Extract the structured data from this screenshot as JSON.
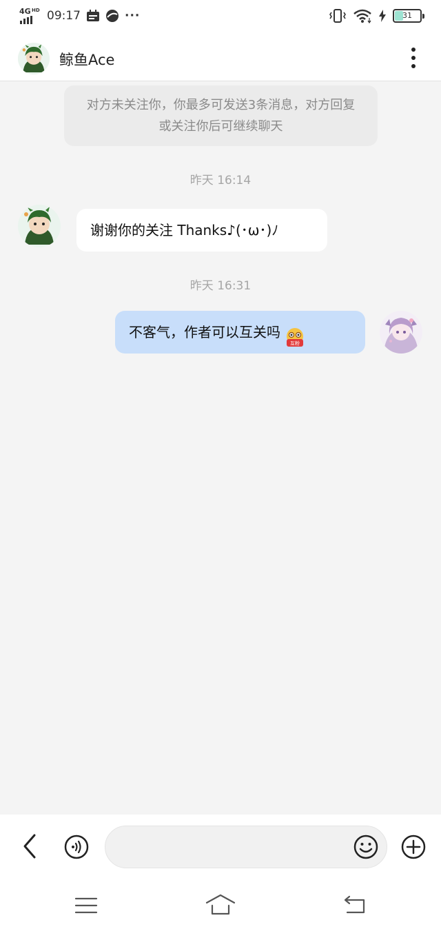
{
  "status_bar": {
    "network": "4G",
    "network_hd": "HD",
    "time": "09:17",
    "more": "···",
    "battery": "31",
    "battery_percent": 31,
    "icons": [
      "signal-icon",
      "calendar-icon",
      "app-icon",
      "vibrate-icon",
      "wifi-icon",
      "charging-icon",
      "battery-icon"
    ]
  },
  "header": {
    "title": "鲸鱼Ace",
    "avatar_icon": "avatar-dino-boy",
    "more_icon": "more-vertical-icon"
  },
  "notice": "对方未关注你，你最多可发送3条消息，对方回复或关注你后可继续聊天",
  "messages": [
    {
      "timestamp": "昨天 16:14",
      "direction": "incoming",
      "text": "谢谢你的关注 Thanks♪(･ω･)ﾉ"
    },
    {
      "timestamp": "昨天 16:31",
      "direction": "outgoing",
      "text": "不客气，作者可以互关吗",
      "emoji_label": "互粉"
    }
  ],
  "input_bar": {
    "message_value": "",
    "icons": [
      "back-arrow-icon",
      "voice-icon",
      "emoji-icon",
      "plus-icon"
    ]
  },
  "system_nav": {
    "icons": [
      "menu-icon",
      "home-icon",
      "back-icon"
    ]
  },
  "colors": {
    "background": "#f4f4f4",
    "outgoing_bubble": "#c8defa",
    "incoming_bubble": "#ffffff",
    "notice_bg": "#ebebeb",
    "timestamp_text": "#a5a5a5",
    "battery_fill": "#9de3d2"
  }
}
